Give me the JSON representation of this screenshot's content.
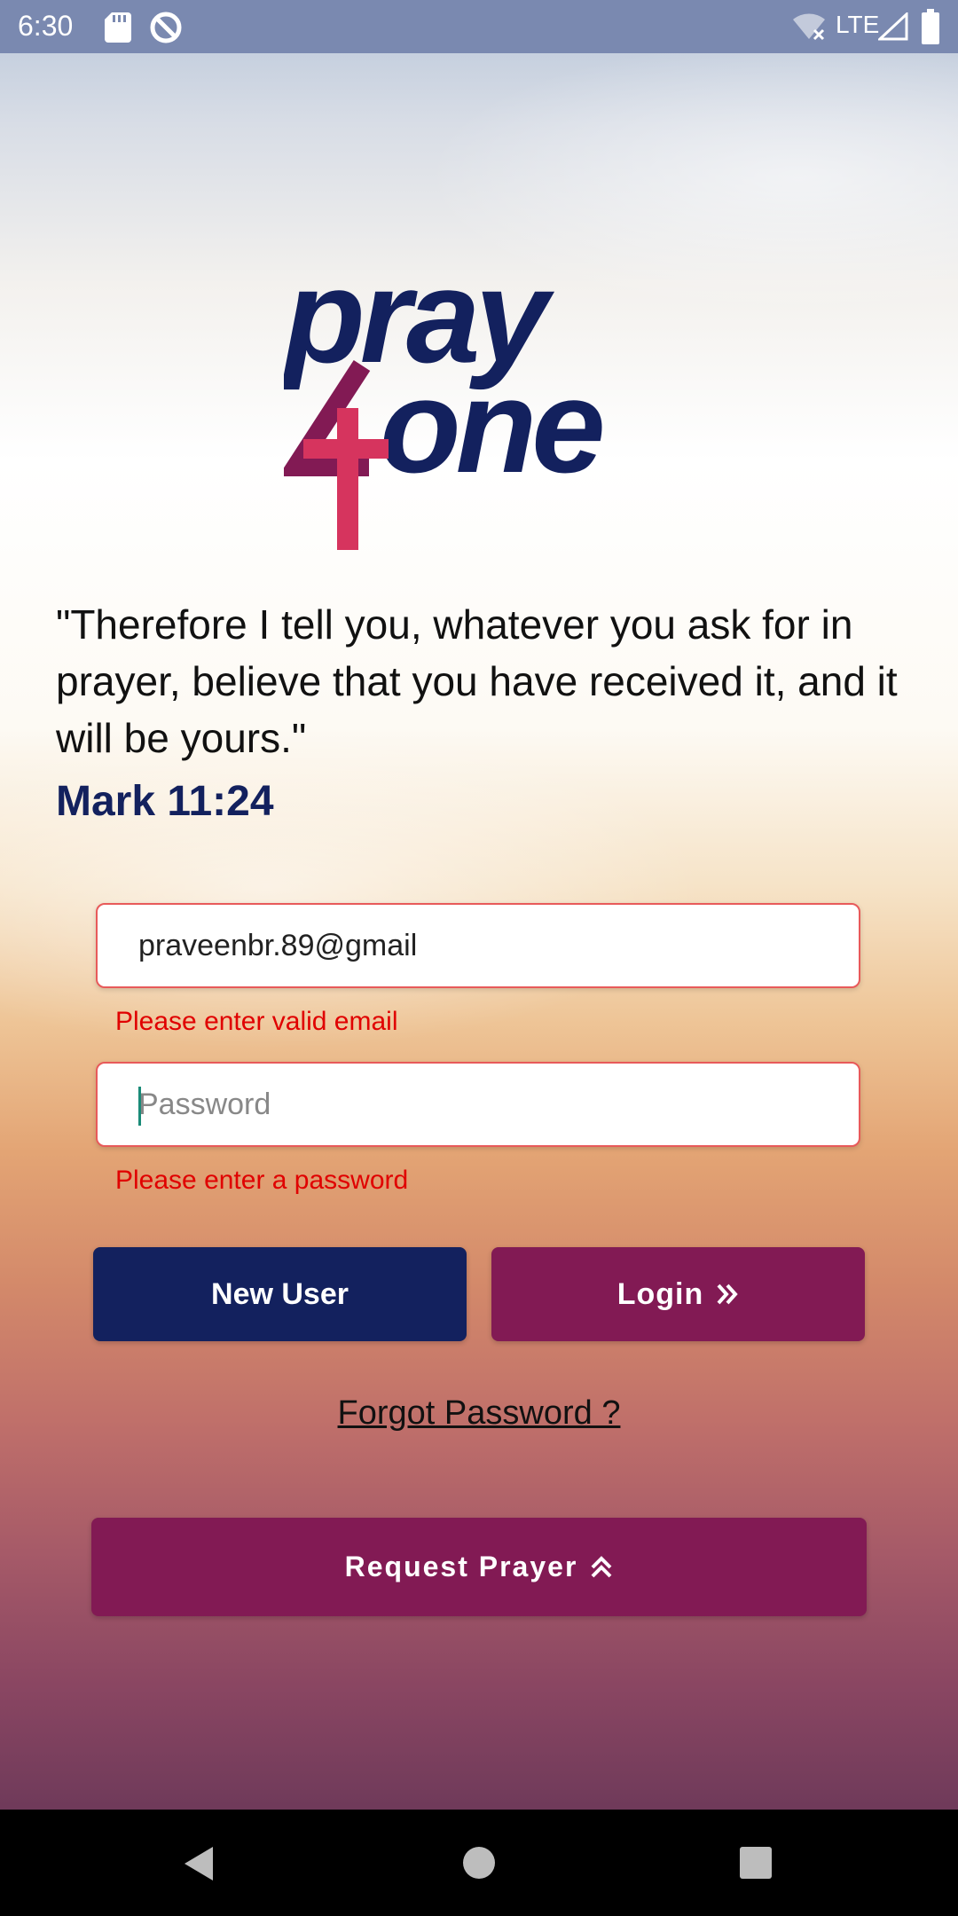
{
  "status_bar": {
    "time": "6:30",
    "network": "LTE",
    "icons": [
      "sd-card-icon",
      "sync-disabled-icon",
      "wifi-off-icon",
      "signal-icon",
      "battery-icon"
    ]
  },
  "logo": {
    "line1": "pray",
    "line2": "one",
    "numeral": "4",
    "colors": {
      "navy": "#13215e",
      "magenta": "#821a54",
      "pink": "#d6345e"
    }
  },
  "quote": {
    "text": "\"Therefore I tell you, whatever you ask for in prayer, believe that you have received it, and it will be yours.\"",
    "reference": "Mark 11:24"
  },
  "form": {
    "email": {
      "value": "praveenbr.89@gmail",
      "error": "Please enter valid email"
    },
    "password": {
      "placeholder": "Password",
      "value": "",
      "error": "Please enter a password"
    }
  },
  "buttons": {
    "new_user": "New User",
    "login": "Login",
    "forgot_password": "Forgot Password ?",
    "request_prayer": "Request Prayer"
  },
  "colors": {
    "primary_navy": "#13215e",
    "primary_magenta": "#821a54",
    "error_red": "#e00000",
    "status_bar": "#7a89b0"
  },
  "nav_bar": {
    "icons": [
      "back-icon",
      "home-icon",
      "recents-icon"
    ]
  }
}
